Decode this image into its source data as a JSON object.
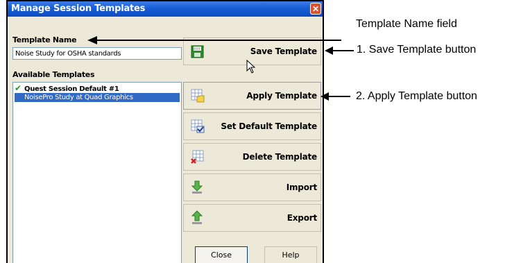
{
  "dialog": {
    "title": "Manage Session Templates",
    "close_glyph": "✕",
    "template_name_label": "Template Name",
    "template_name_value": "Noise Study for OSHA standards",
    "available_label": "Available Templates",
    "templates": [
      {
        "name": "Quest Session Default #1",
        "default": true,
        "selected": false
      },
      {
        "name": "NoisePro Study at Quad Graphics",
        "default": false,
        "selected": true
      }
    ],
    "buttons": {
      "save": "Save Template",
      "apply": "Apply Template",
      "set_default": "Set Default Template",
      "delete": "Delete Template",
      "import": "Import",
      "export": "Export",
      "close": "Close",
      "help": "Help"
    },
    "icons": {
      "save": "floppy-disk-icon",
      "apply": "grid-folder-icon",
      "set_default": "grid-check-icon",
      "delete": "grid-delete-icon",
      "import": "arrow-down-icon",
      "export": "arrow-up-icon"
    },
    "colors": {
      "titlebar": "#0b4cc4",
      "selection": "#316ac5",
      "check": "#1a9c1a"
    }
  },
  "annotations": {
    "template_name": "Template Name field",
    "save": "1. Save Template button",
    "apply": "2. Apply Template button"
  }
}
